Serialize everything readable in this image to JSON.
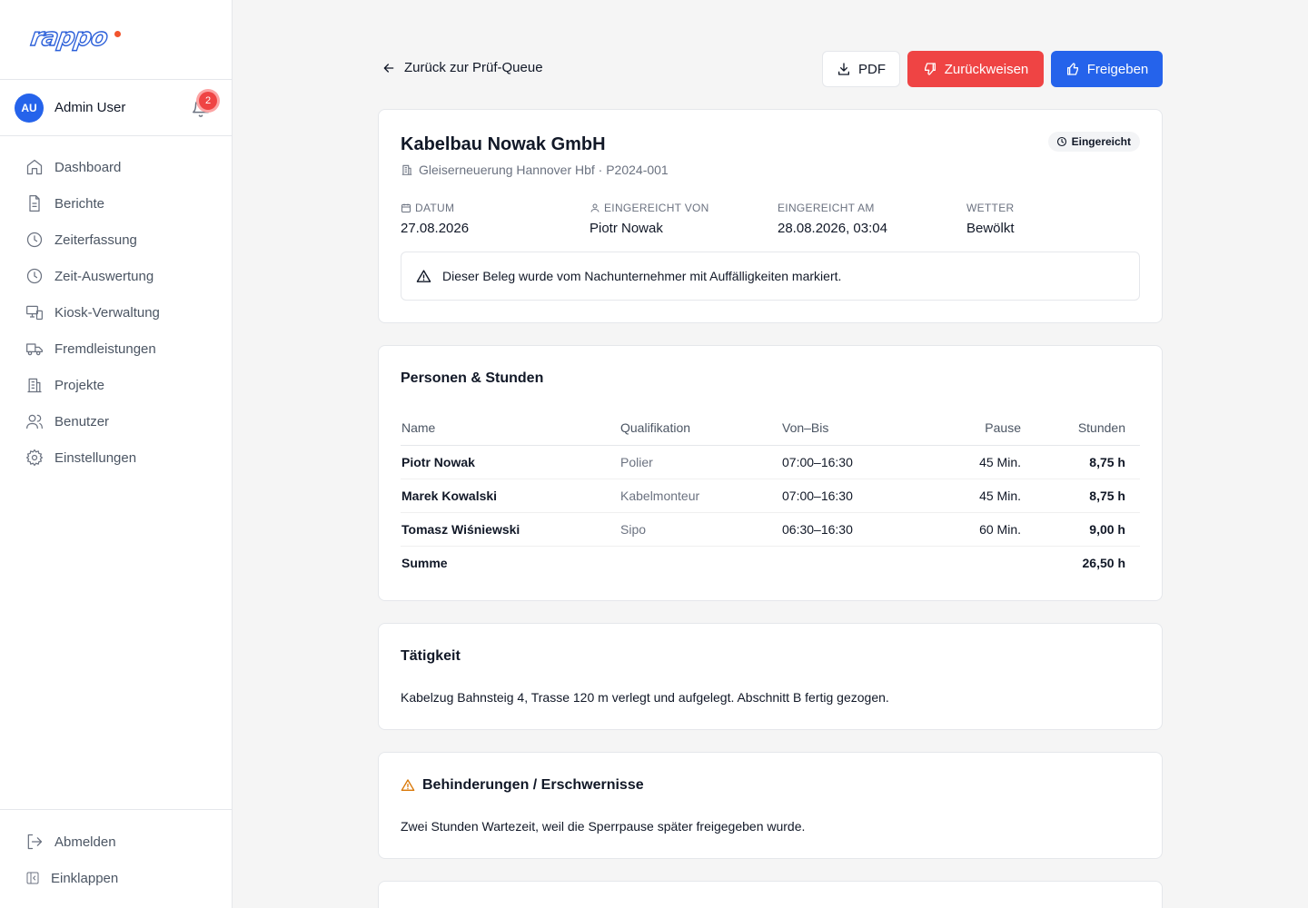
{
  "brand": {
    "name": "rappo"
  },
  "user": {
    "initials": "AU",
    "name": "Admin User",
    "notifications": "2"
  },
  "nav": {
    "items": [
      {
        "label": "Dashboard"
      },
      {
        "label": "Berichte"
      },
      {
        "label": "Zeiterfassung"
      },
      {
        "label": "Zeit-Auswertung"
      },
      {
        "label": "Kiosk-Verwaltung"
      },
      {
        "label": "Fremdleistungen"
      },
      {
        "label": "Projekte"
      },
      {
        "label": "Benutzer"
      },
      {
        "label": "Einstellungen"
      }
    ],
    "bottom": [
      {
        "label": "Abmelden"
      },
      {
        "label": "Einklappen"
      }
    ]
  },
  "toolbar": {
    "back_label": "Zurück zur Prüf-Queue",
    "pdf_label": "PDF",
    "reject_label": "Zurückweisen",
    "approve_label": "Freigeben"
  },
  "report": {
    "company": "Kabelbau Nowak GmbH",
    "project": "Gleiserneuerung Hannover Hbf · P2024-001",
    "status": "Eingereicht",
    "meta": [
      {
        "label": "DATUM",
        "value": "27.08.2026"
      },
      {
        "label": "EINGEREICHT VON",
        "value": "Piotr Nowak"
      },
      {
        "label": "EINGEREICHT AM",
        "value": "28.08.2026, 03:04"
      },
      {
        "label": "WETTER",
        "value": "Bewölkt"
      }
    ],
    "alert": "Dieser Beleg wurde vom Nachunternehmer mit Auffälligkeiten markiert."
  },
  "persons": {
    "title": "Personen & Stunden",
    "columns": {
      "name": "Name",
      "qualification": "Qualifikation",
      "time": "Von–Bis",
      "pause": "Pause",
      "hours": "Stunden"
    },
    "rows": [
      {
        "name": "Piotr Nowak",
        "qualification": "Polier",
        "time": "07:00–16:30",
        "pause": "45 Min.",
        "hours": "8,75 h"
      },
      {
        "name": "Marek Kowalski",
        "qualification": "Kabelmonteur",
        "time": "07:00–16:30",
        "pause": "45 Min.",
        "hours": "8,75 h"
      },
      {
        "name": "Tomasz Wiśniewski",
        "qualification": "Sipo",
        "time": "06:30–16:30",
        "pause": "60 Min.",
        "hours": "9,00 h"
      }
    ],
    "sum_label": "Summe",
    "sum_value": "26,50 h"
  },
  "activity": {
    "title": "Tätigkeit",
    "text": "Kabelzug Bahnsteig 4, Trasse 120 m verlegt und aufgelegt. Abschnitt B fertig gezogen."
  },
  "obstructions": {
    "title": "Behinderungen / Erschwernisse",
    "text": "Zwei Stunden Wartezeit, weil die Sperrpause später freigegeben wurde."
  },
  "colors": {
    "primary": "#2563eb",
    "danger": "#ef4444",
    "warning": "#d97706",
    "logo_dot": "#f2542d"
  },
  "icons": [
    "home-icon",
    "file-icon",
    "clock-icon",
    "clock-icon",
    "kiosk-icon",
    "truck-icon",
    "building-icon",
    "users-icon",
    "gear-icon",
    "logout-icon",
    "collapse-icon",
    "bell-icon",
    "arrow-left-icon",
    "download-icon",
    "thumbs-down-icon",
    "thumbs-up-icon",
    "building-icon",
    "clock-icon",
    "calendar-icon",
    "user-icon",
    "warning-icon"
  ]
}
